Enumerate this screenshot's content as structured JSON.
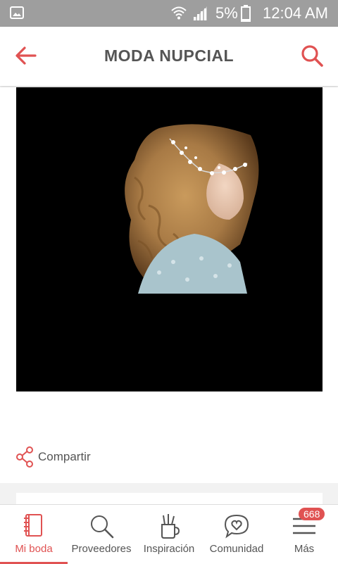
{
  "status_bar": {
    "battery_percent": "5%",
    "time": "12:04 AM"
  },
  "app_bar": {
    "title": "MODA NUPCIAL"
  },
  "content": {
    "share_label": "Compartir"
  },
  "bottom_nav": {
    "items": [
      {
        "label": "Mi boda",
        "icon": "notebook-icon",
        "active": true
      },
      {
        "label": "Proveedores",
        "icon": "search-icon"
      },
      {
        "label": "Inspiración",
        "icon": "pencil-cup-icon"
      },
      {
        "label": "Comunidad",
        "icon": "chat-heart-icon"
      },
      {
        "label": "Más",
        "icon": "menu-icon",
        "badge": "668"
      }
    ]
  },
  "colors": {
    "accent": "#e05252",
    "status_bar": "#9e9e9e"
  }
}
